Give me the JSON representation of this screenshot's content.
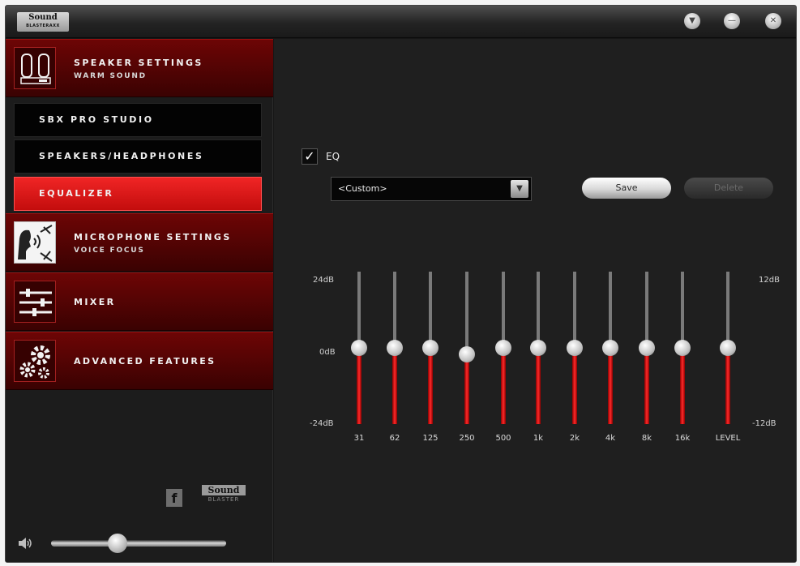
{
  "titlebar": {
    "logo_line1": "Sound",
    "logo_line2": "BLASTERAXX",
    "buttons": [
      {
        "name": "dropdown-button",
        "icon": "chevron-down-icon",
        "glyph": "▼"
      },
      {
        "name": "minimize-button",
        "icon": "minimize-icon",
        "glyph": "—"
      },
      {
        "name": "close-button",
        "icon": "close-icon",
        "glyph": "✕"
      }
    ]
  },
  "sidebar": {
    "speaker": {
      "title": "SPEAKER SETTINGS",
      "subtitle": "WARM SOUND",
      "icon": "speaker-icon"
    },
    "sub_items": [
      {
        "label": "SBX PRO STUDIO",
        "active": false
      },
      {
        "label": "SPEAKERS/HEADPHONES",
        "active": false
      },
      {
        "label": "EQUALIZER",
        "active": true
      }
    ],
    "microphone": {
      "title": "MICROPHONE SETTINGS",
      "subtitle": "VOICE FOCUS",
      "icon": "microphone-icon"
    },
    "mixer": {
      "title": "MIXER",
      "icon": "mixer-icon"
    },
    "advanced": {
      "title": "ADVANCED FEATURES",
      "icon": "gears-icon"
    },
    "facebook_glyph": "f",
    "brand_line1": "Sound",
    "brand_line2": "BLASTER",
    "volume": {
      "level": 0.38,
      "icon": "speaker-volume-icon"
    }
  },
  "equalizer": {
    "eq_enabled": true,
    "eq_label": "EQ",
    "check_glyph": "✓",
    "preset": {
      "value": "<Custom>",
      "arrow": "▼"
    },
    "save_label": "Save",
    "delete_label": "Delete",
    "left_scale": {
      "top": "24dB",
      "mid": "0dB",
      "bottom": "-24dB"
    },
    "right_scale": {
      "top": "12dB",
      "bottom": "-12dB"
    },
    "bands": [
      {
        "label": "31",
        "gain_db": 0
      },
      {
        "label": "62",
        "gain_db": 0
      },
      {
        "label": "125",
        "gain_db": 0
      },
      {
        "label": "250",
        "gain_db": -2
      },
      {
        "label": "500",
        "gain_db": 0
      },
      {
        "label": "1k",
        "gain_db": 0
      },
      {
        "label": "2k",
        "gain_db": 0
      },
      {
        "label": "4k",
        "gain_db": 0
      },
      {
        "label": "8k",
        "gain_db": 0
      },
      {
        "label": "16k",
        "gain_db": 0
      }
    ],
    "level": {
      "label": "LEVEL",
      "gain_db": 0
    },
    "colors": {
      "accent_red": "#e81818",
      "sidebar_red": "#5a0303"
    }
  }
}
